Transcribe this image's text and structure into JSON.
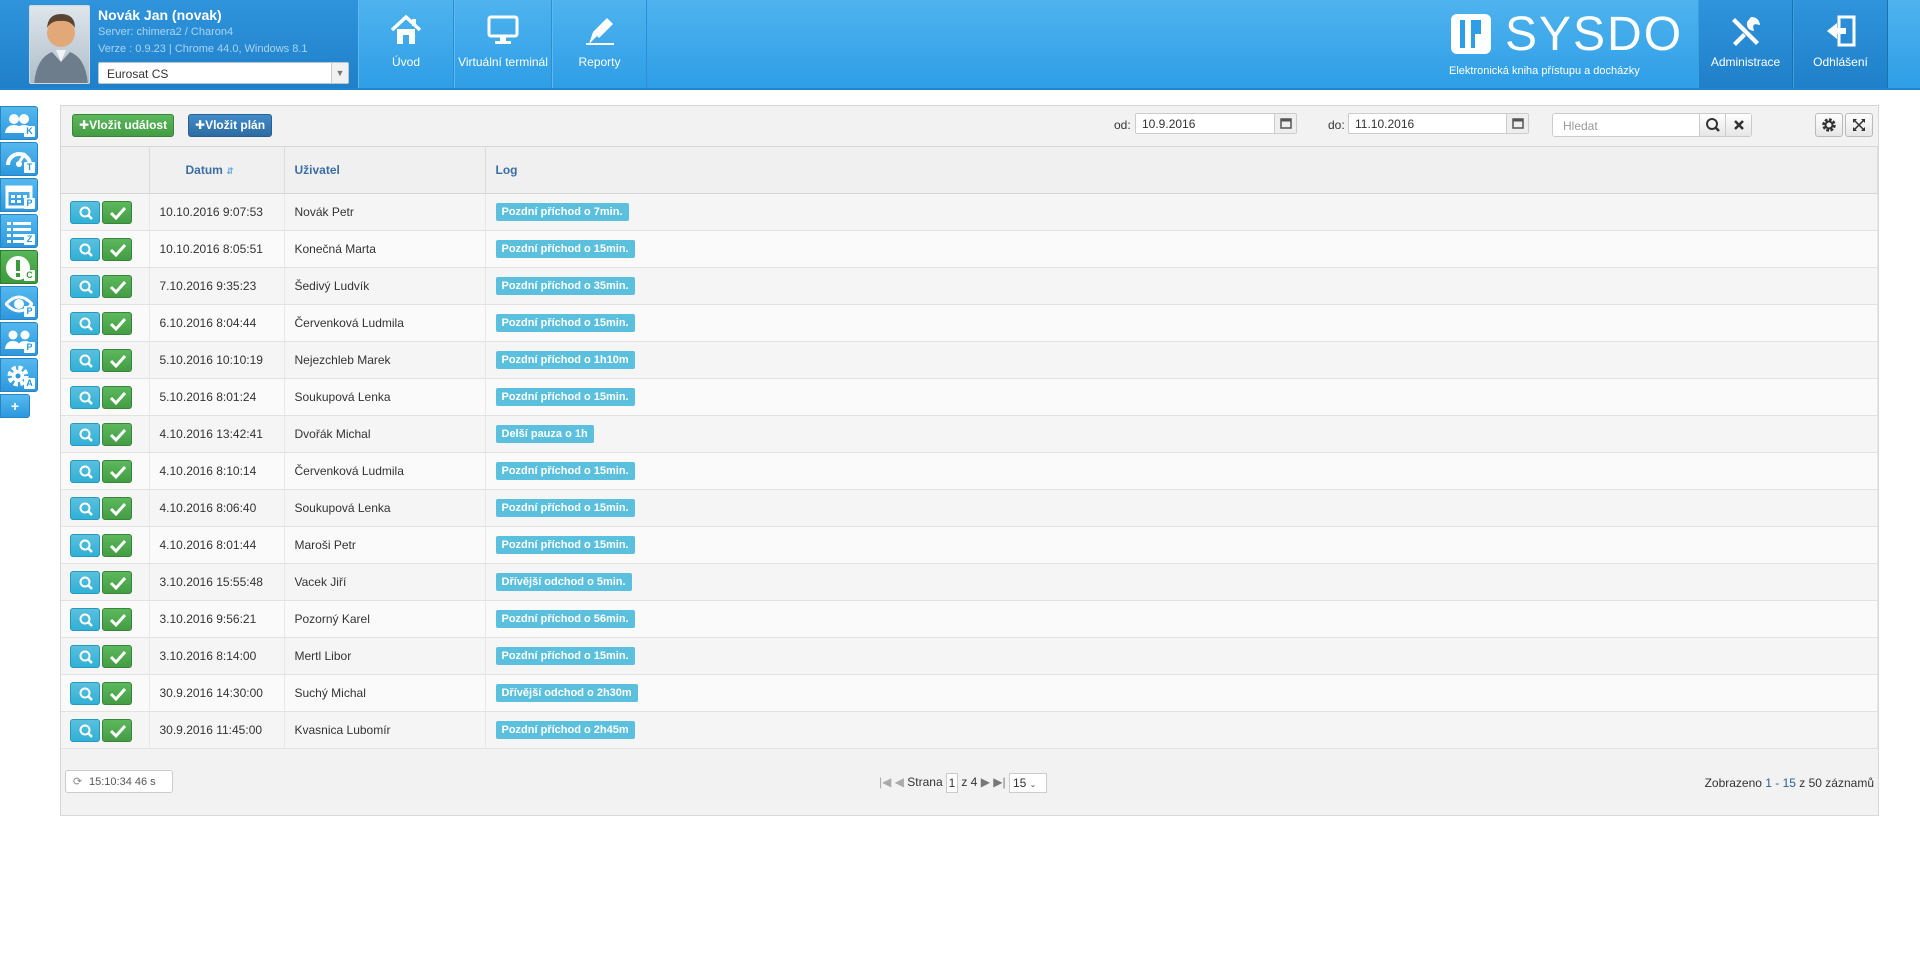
{
  "user": {
    "name": "Novák Jan (novak)",
    "server": "Server: chimera2 / Charon4",
    "version": "Verze : 0.9.23 | Chrome 44.0, Windows 8.1",
    "company": "Eurosat CS"
  },
  "nav": {
    "home": "Úvod",
    "terminal": "Virtuální terminál",
    "reports": "Reporty",
    "admin": "Administrace",
    "logout": "Odhlášení"
  },
  "logo": {
    "name": "SYSDO",
    "subtitle": "Elektronická kniha přístupu a docházky"
  },
  "sidebar": {
    "items": [
      {
        "icon": "users-icon",
        "letter": "K"
      },
      {
        "icon": "dashboard-icon",
        "letter": "T"
      },
      {
        "icon": "calendar-icon",
        "letter": "P"
      },
      {
        "icon": "list-icon",
        "letter": "Z"
      },
      {
        "icon": "alert-icon",
        "letter": "C"
      },
      {
        "icon": "eye-icon",
        "letter": "P"
      },
      {
        "icon": "group-icon",
        "letter": "P"
      },
      {
        "icon": "gear-icon",
        "letter": "A"
      }
    ],
    "add": "+"
  },
  "toolbar": {
    "insert_event": "Vložit událost",
    "insert_plan": "Vložit plán",
    "from_label": "od:",
    "from_value": "10.9.2016",
    "to_label": "do:",
    "to_value": "11.10.2016",
    "search_placeholder": "Hledat"
  },
  "table": {
    "columns": [
      "",
      "Datum",
      "Uživatel",
      "Log"
    ],
    "rows": [
      {
        "date": "10.10.2016 9:07:53",
        "user": "Novák Petr",
        "log": "Pozdní příchod o 7min."
      },
      {
        "date": "10.10.2016 8:05:51",
        "user": "Konečná Marta",
        "log": "Pozdní příchod o 15min."
      },
      {
        "date": "7.10.2016 9:35:23",
        "user": "Šedivý Ludvík",
        "log": "Pozdní příchod o 35min."
      },
      {
        "date": "6.10.2016 8:04:44",
        "user": "Červenková Ludmila",
        "log": "Pozdní příchod o 15min."
      },
      {
        "date": "5.10.2016 10:10:19",
        "user": "Nejezchleb Marek",
        "log": "Pozdní příchod o 1h10m"
      },
      {
        "date": "5.10.2016 8:01:24",
        "user": "Soukupová Lenka",
        "log": "Pozdní příchod o 15min."
      },
      {
        "date": "4.10.2016 13:42:41",
        "user": "Dvořák Michal",
        "log": "Delší pauza o 1h"
      },
      {
        "date": "4.10.2016 8:10:14",
        "user": "Červenková Ludmila",
        "log": "Pozdní příchod o 15min."
      },
      {
        "date": "4.10.2016 8:06:40",
        "user": "Soukupová Lenka",
        "log": "Pozdní příchod o 15min."
      },
      {
        "date": "4.10.2016 8:01:44",
        "user": "Maroši Petr",
        "log": "Pozdní příchod o 15min."
      },
      {
        "date": "3.10.2016 15:55:48",
        "user": "Vacek Jiří",
        "log": "Dřívější odchod o 5min."
      },
      {
        "date": "3.10.2016 9:56:21",
        "user": "Pozorný Karel",
        "log": "Pozdní příchod o 56min."
      },
      {
        "date": "3.10.2016 8:14:00",
        "user": "Mertl Libor",
        "log": "Pozdní příchod o 15min."
      },
      {
        "date": "30.9.2016 14:30:00",
        "user": "Suchý Michal",
        "log": "Dřívější odchod o 2h30m"
      },
      {
        "date": "30.9.2016 11:45:00",
        "user": "Kvasnica Lubomír",
        "log": "Pozdní příchod o 2h45m"
      }
    ]
  },
  "footer": {
    "refresh": "15:10:34  46 s",
    "page_label": "Strana",
    "page_current": "1",
    "page_of": "z 4",
    "page_size": "15",
    "count_prefix": "Zobrazeno ",
    "count_range": "1 - 15",
    "count_suffix": " z 50 záznamů"
  },
  "colors": {
    "header": "#2e9ee6",
    "green": "#5cb85c",
    "blue": "#428bca",
    "info": "#5bc0de"
  }
}
